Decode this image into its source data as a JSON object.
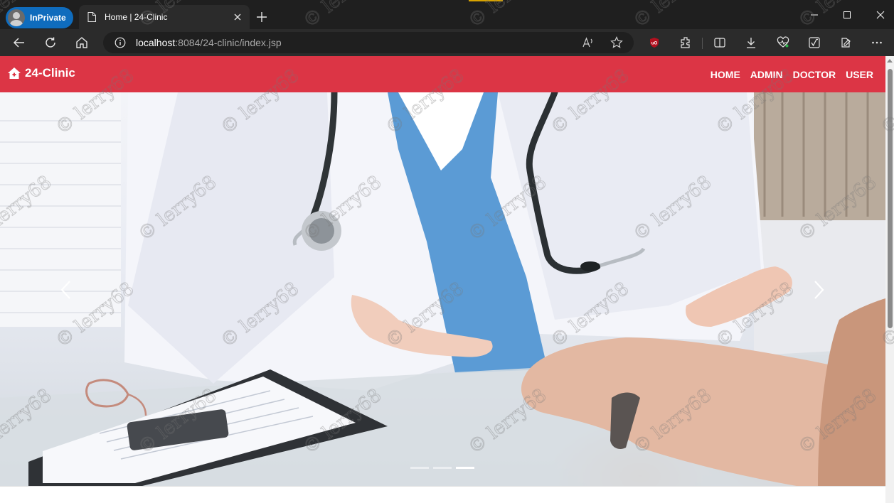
{
  "browser": {
    "profile_label": "InPrivate",
    "tab_title": "Home | 24-Clinic",
    "url_host": "localhost",
    "url_rest": ":8084/24-clinic/index.jsp"
  },
  "site": {
    "brand": "24-Clinic",
    "nav": [
      "HOME",
      "ADMIN",
      "DOCTOR",
      "USER"
    ],
    "accent_color": "#dc3545"
  },
  "carousel": {
    "slides_count": 3,
    "active_index": 2,
    "prev_icon": "chevron-left-icon",
    "next_icon": "chevron-right-icon"
  },
  "watermark": "© lerry68"
}
